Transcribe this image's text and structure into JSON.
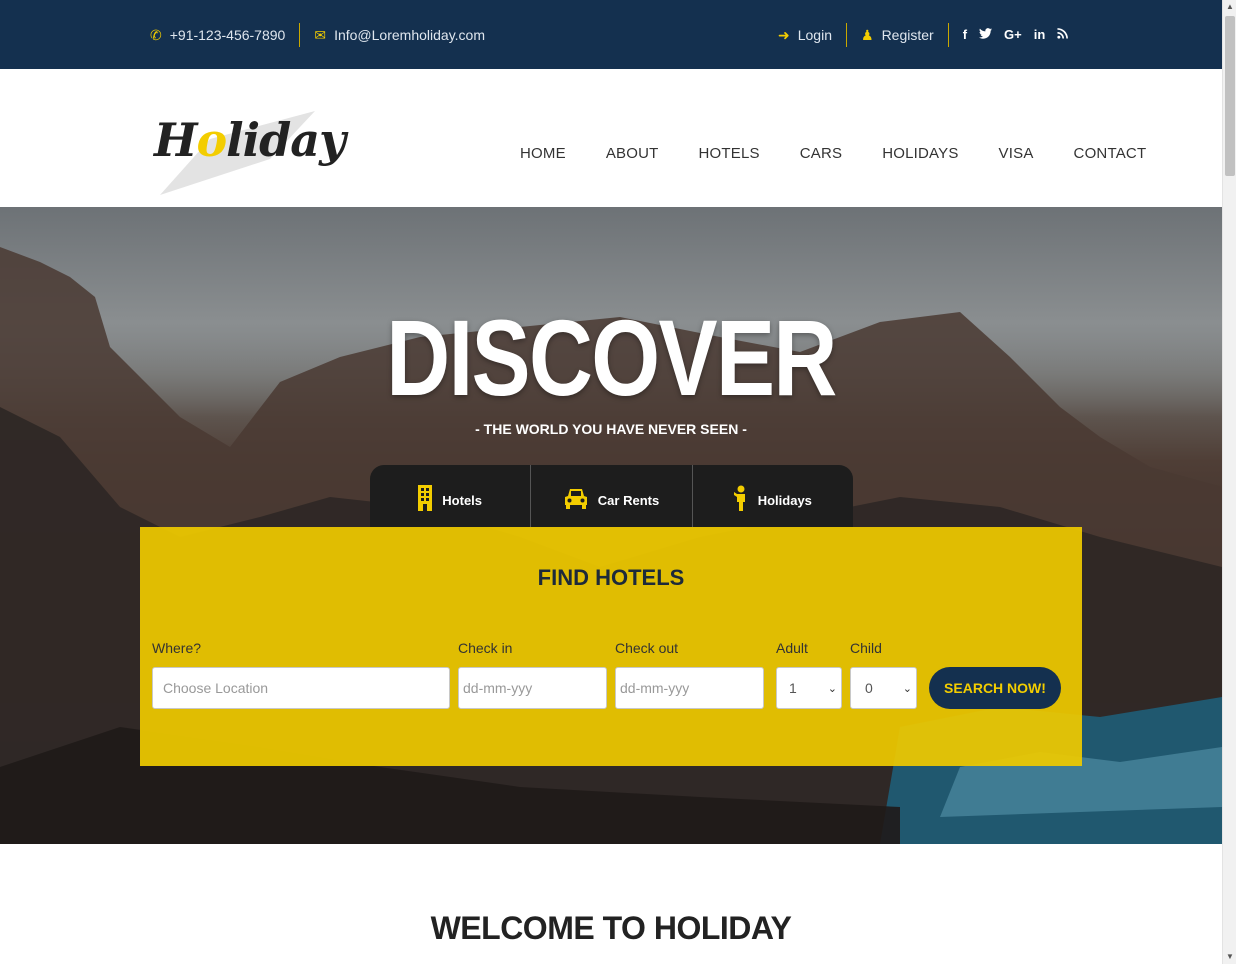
{
  "topbar": {
    "phone": "+91-123-456-7890",
    "email": "Info@Loremholiday.com",
    "login": "Login",
    "register": "Register",
    "social": [
      {
        "label": "f",
        "icon": "facebook-icon"
      },
      {
        "label": "t",
        "icon": "twitter-icon"
      },
      {
        "label": "G+",
        "icon": "google-plus-icon"
      },
      {
        "label": "in",
        "icon": "linkedin-icon"
      },
      {
        "label": "rss",
        "icon": "rss-icon"
      }
    ],
    "icons": {
      "phone": "phone-icon",
      "email": "envelope-icon",
      "login": "sign-in-icon",
      "register": "user-icon"
    }
  },
  "logo": {
    "text_pre": "H",
    "text_o": "o",
    "text_post": "liday"
  },
  "nav": [
    "HOME",
    "ABOUT",
    "HOTELS",
    "CARS",
    "HOLIDAYS",
    "VISA",
    "CONTACT"
  ],
  "hero": {
    "title": "DISCOVER",
    "subtitle": "- THE WORLD YOU HAVE NEVER SEEN -"
  },
  "tabs": [
    {
      "label": "Hotels",
      "icon": "building-icon"
    },
    {
      "label": "Car Rents",
      "icon": "car-icon"
    },
    {
      "label": "Holidays",
      "icon": "person-icon"
    }
  ],
  "search": {
    "title": "FIND HOTELS",
    "where_label": "Where?",
    "where_placeholder": "Choose Location",
    "checkin_label": "Check in",
    "checkin_placeholder": "dd-mm-yyy",
    "checkout_label": "Check out",
    "checkout_placeholder": "dd-mm-yyy",
    "adult_label": "Adult",
    "adult_value": "1",
    "child_label": "Child",
    "child_value": "0",
    "button": "SEARCH NOW!"
  },
  "welcome": {
    "title": "WELCOME TO HOLIDAY"
  },
  "colors": {
    "navy": "#14304f",
    "yellow": "#f3cd00",
    "panel": "#eec900"
  }
}
